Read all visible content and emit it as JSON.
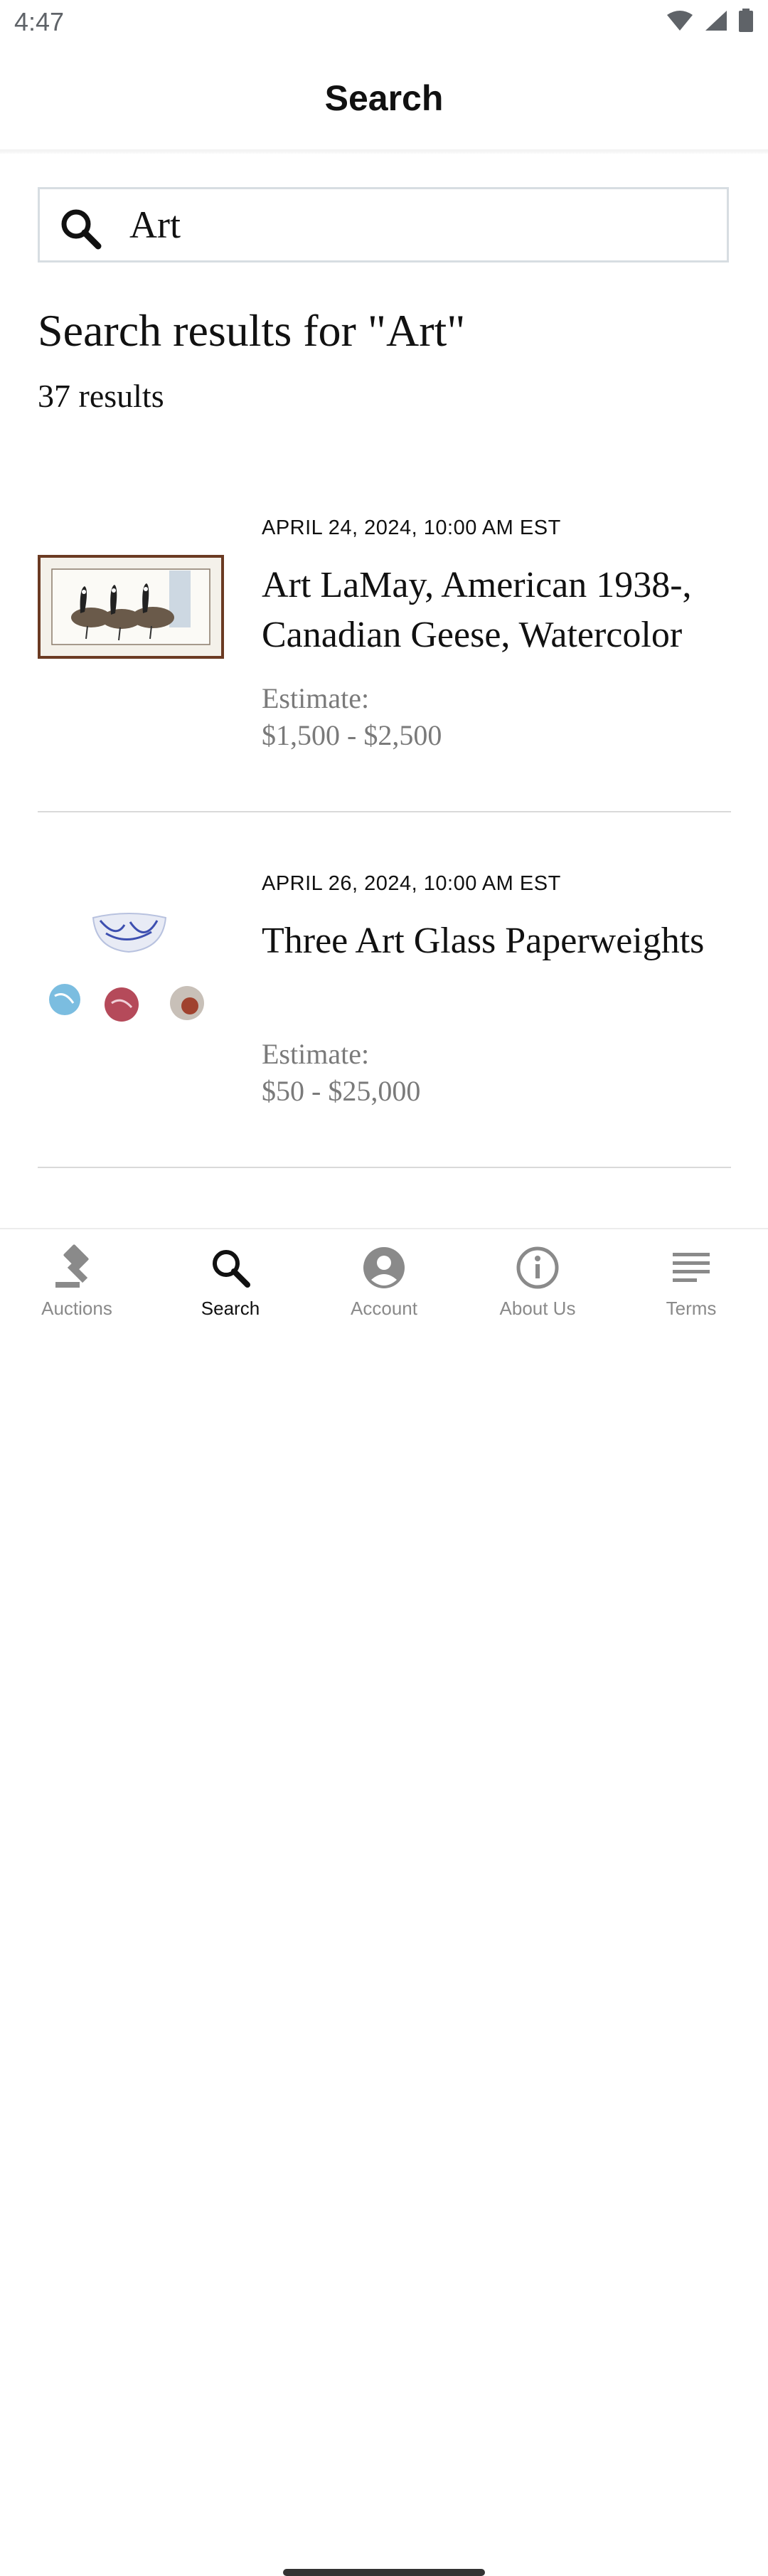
{
  "status_bar": {
    "time": "4:47",
    "icons": [
      "wifi-icon",
      "cell-signal-icon",
      "battery-icon"
    ]
  },
  "header": {
    "title": "Search"
  },
  "search": {
    "value": "Art",
    "icon": "search-icon"
  },
  "results": {
    "heading": "Search results for \"Art\"",
    "count_text": "37 results",
    "items": [
      {
        "date": "APRIL 24, 2024, 10:00 AM EST",
        "title": "Art LaMay, American 1938-, Canadian Geese, Watercolor",
        "estimate_label": "Estimate:",
        "estimate_range": "$1,500 - $2,500"
      },
      {
        "date": "APRIL 26, 2024, 10:00 AM EST",
        "title": "Three Art Glass Paperweights",
        "estimate_label": "Estimate:",
        "estimate_range": "$50 - $25,000"
      }
    ]
  },
  "bottom_nav": {
    "items": [
      {
        "label": "Auctions",
        "icon": "gavel-icon",
        "active": false
      },
      {
        "label": "Search",
        "icon": "search-icon",
        "active": true
      },
      {
        "label": "Account",
        "icon": "account-circle-icon",
        "active": false
      },
      {
        "label": "About Us",
        "icon": "info-icon",
        "active": false
      },
      {
        "label": "Terms",
        "icon": "list-lines-icon",
        "active": false
      }
    ]
  },
  "colors": {
    "text": "#111111",
    "muted": "#7a7a7a",
    "nav_inactive": "#8a8a8a",
    "nav_active": "#111111",
    "divider": "#d9d9d9"
  }
}
